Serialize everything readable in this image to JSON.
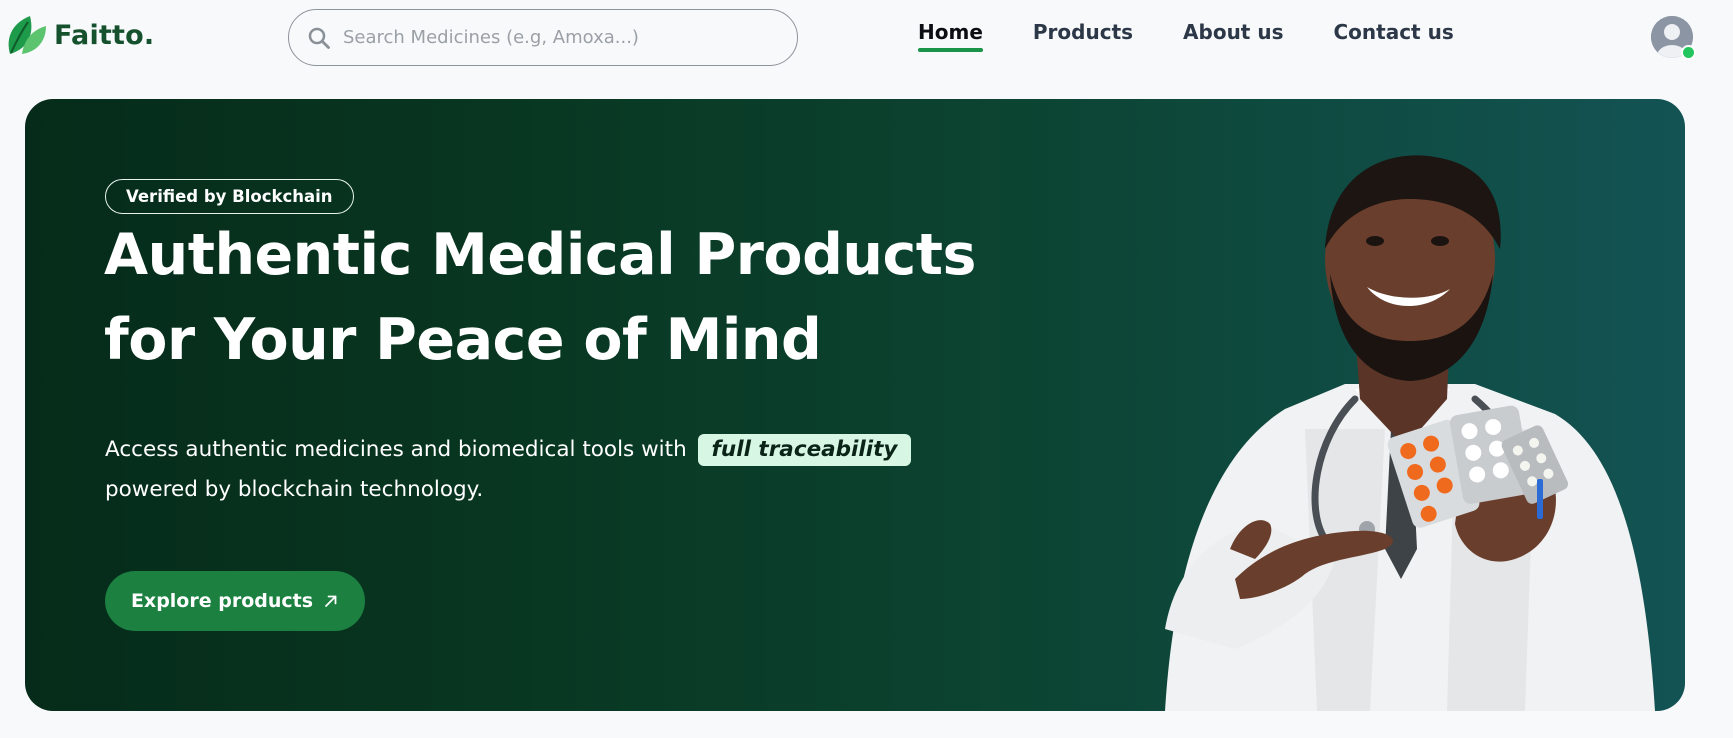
{
  "brand": {
    "name": "Faitto.",
    "logo_icon": "leaf-icon",
    "color": "#14512c"
  },
  "search": {
    "placeholder": "Search Medicines (e.g, Amoxa...)",
    "value": "",
    "icon": "search-icon"
  },
  "nav": {
    "items": [
      {
        "label": "Home",
        "active": true
      },
      {
        "label": "Products",
        "active": false
      },
      {
        "label": "About us",
        "active": false
      },
      {
        "label": "Contact us",
        "active": false
      }
    ],
    "active_color": "#1a9448"
  },
  "user": {
    "avatar_icon": "user-avatar-icon",
    "status": "online",
    "status_color": "#22c55e"
  },
  "hero": {
    "badge": "Verified by Blockchain",
    "headline_line1": "Authentic Medical Products",
    "headline_line2": "for Your Peace of Mind",
    "desc_before": "Access authentic medicines and biomedical tools with",
    "desc_highlight": "full traceability",
    "desc_after": "powered by blockchain technology.",
    "cta_label": "Explore products",
    "cta_icon": "arrow-up-right-icon",
    "cta_color": "#1b8040",
    "image_subject": "doctor-holding-pill-blister-packs"
  }
}
